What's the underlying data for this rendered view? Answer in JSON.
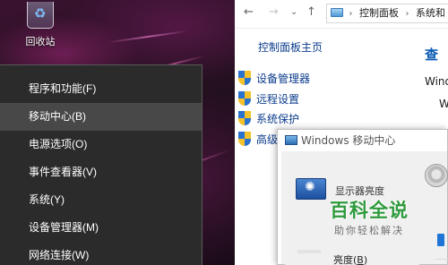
{
  "desktop": {
    "recycle_bin_label": "回收站"
  },
  "winx_menu": {
    "items": [
      {
        "label": "程序和功能(F)"
      },
      {
        "label": "移动中心(B)"
      },
      {
        "label": "电源选项(O)"
      },
      {
        "label": "事件查看器(V)"
      },
      {
        "label": "系统(Y)"
      },
      {
        "label": "设备管理器(M)"
      },
      {
        "label": "网络连接(W)"
      }
    ],
    "highlighted_index": 1
  },
  "control_panel": {
    "nav": {
      "back": "←",
      "forward": "→",
      "recent": "⌄",
      "up": "↑"
    },
    "breadcrumb": [
      "控制面板",
      "系统和"
    ],
    "home_link": "控制面板主页",
    "right_title": "查",
    "right_sub": "Wind",
    "right_sub2": "W",
    "side_links": [
      "设备管理器",
      "远程设置",
      "系统保护",
      "高级"
    ]
  },
  "mobility_center": {
    "title_prefix": "Windows",
    "title_suffix": "移动中心",
    "brightness_label": "显示器亮度",
    "brightness_caption_text": "亮度(",
    "brightness_caption_key": "B",
    "brightness_caption_end": ")"
  },
  "watermark": {
    "main": "百科全说",
    "sub": "助你轻松解决"
  },
  "colors": {
    "link": "#0b3c8c",
    "menu_bg": "#2b2b2b",
    "menu_hover": "#484848",
    "watermark_green": "#2e9a3c"
  }
}
